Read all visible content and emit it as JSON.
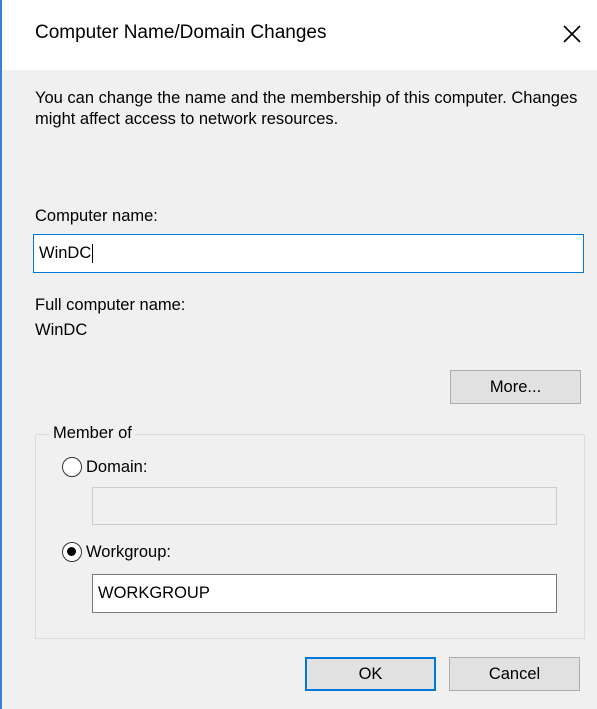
{
  "dialog": {
    "title": "Computer Name/Domain Changes",
    "close_icon": "close-icon",
    "description": "You can change the name and the membership of this computer. Changes might affect access to network resources."
  },
  "computer_name": {
    "label": "Computer name:",
    "value": "WinDC"
  },
  "full_name": {
    "label": "Full computer name:",
    "value": "WinDC"
  },
  "more_button": {
    "label": "More..."
  },
  "member_of": {
    "legend": "Member of",
    "domain": {
      "label": "Domain:",
      "selected": false,
      "value": ""
    },
    "workgroup": {
      "label": "Workgroup:",
      "selected": true,
      "value": "WORKGROUP"
    }
  },
  "buttons": {
    "ok": "OK",
    "cancel": "Cancel"
  },
  "colors": {
    "accent": "#0078d7",
    "dialog_background": "#f0f0f0"
  }
}
